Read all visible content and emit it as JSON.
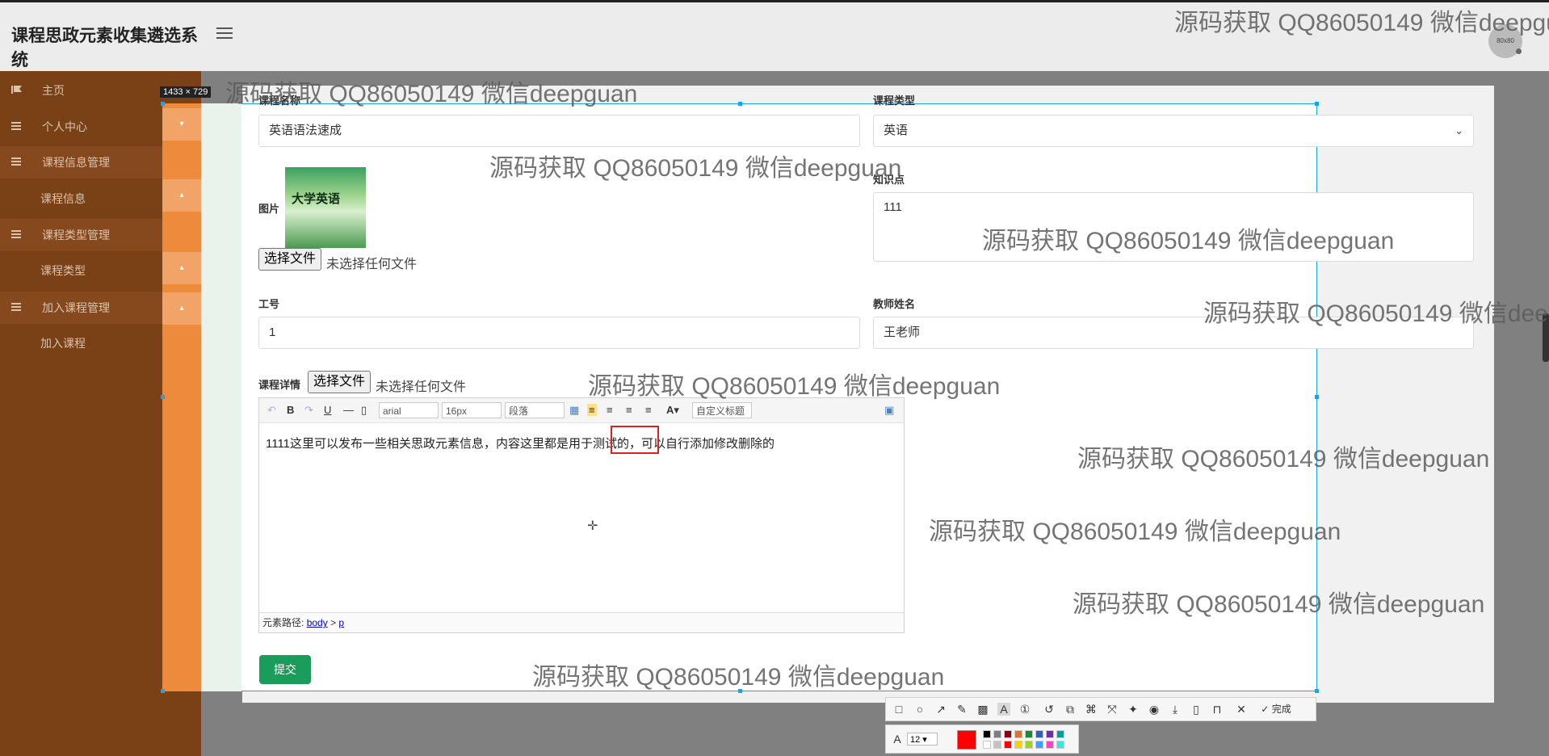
{
  "app": {
    "title": "课程思政元素收集遴选系统"
  },
  "avatar": {
    "text": "80x80"
  },
  "sidebar": {
    "items": [
      {
        "label": "主页"
      },
      {
        "label": "个人中心"
      },
      {
        "label": "课程信息管理"
      },
      {
        "label": "课程信息"
      },
      {
        "label": "课程类型管理"
      },
      {
        "label": "课程类型"
      },
      {
        "label": "加入课程管理"
      },
      {
        "label": "加入课程"
      }
    ]
  },
  "capture": {
    "size_label": "1433 × 729"
  },
  "form": {
    "course_name": {
      "label": "课程名称",
      "value": "英语语法速成"
    },
    "course_type": {
      "label": "课程类型",
      "value": "英语"
    },
    "image": {
      "label": "图片",
      "book_title": "大学英语"
    },
    "file_button": "选择文件",
    "file_none": "未选择任何文件",
    "knowledge": {
      "label": "知识点",
      "value": "111"
    },
    "staff_id": {
      "label": "工号",
      "value": "1"
    },
    "teacher_name": {
      "label": "教师姓名",
      "value": "王老师"
    },
    "details": {
      "label": "课程详情"
    },
    "submit_label": "提交"
  },
  "editor": {
    "font_family": "arial",
    "font_size": "16px",
    "paragraph": "段落",
    "custom_title": "自定义标题",
    "content": "1111这里可以发布一些相关思政元素信息，内容这里都是用于测试的，可以自行添加修改删除的",
    "path_label": "元素路径:",
    "path_body": "body",
    "path_sep": ">",
    "path_p": "p"
  },
  "watermark": "源码获取 QQ86050149 微信deepguan",
  "snip_tool": {
    "done_label": "完成",
    "font_size": "12",
    "accent": "#ff0000"
  }
}
